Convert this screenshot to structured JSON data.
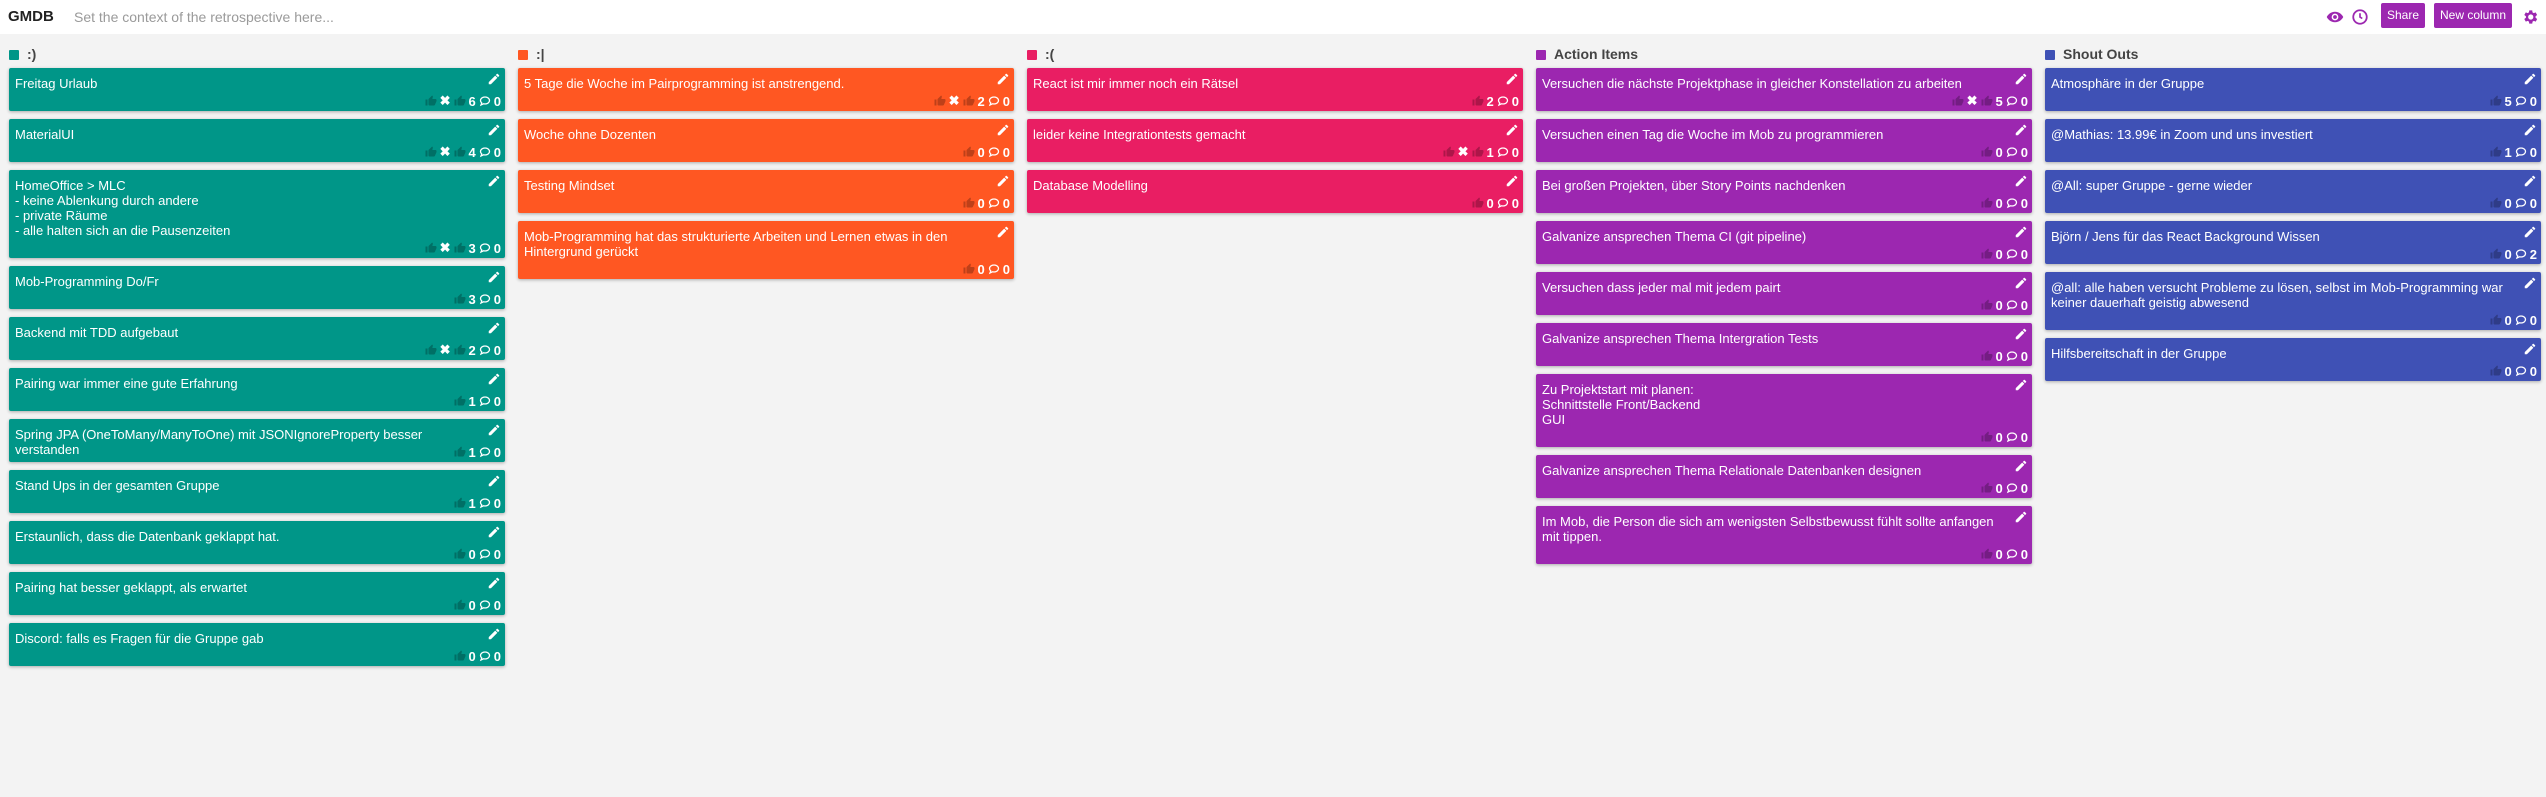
{
  "header": {
    "brand": "GMDB",
    "context_placeholder": "Set the context of the retrospective here...",
    "context_value": "",
    "share_label": "Share",
    "new_column_label": "New column"
  },
  "icons": {
    "visibility": "eye-icon",
    "timer": "clock-icon",
    "settings": "gear-icon",
    "edit": "pencil-icon",
    "thumbs_up": "thumbs-up-icon",
    "delete": "x-icon",
    "comment": "comment-icon"
  },
  "accent": "#9c27b0",
  "add_label": "+",
  "columns": [
    {
      "title": ":)",
      "color": "#009688",
      "cards": [
        {
          "text": "Freitag Urlaub",
          "votes": "6",
          "comments": "0",
          "deletable": true
        },
        {
          "text": "MaterialUI",
          "votes": "4",
          "comments": "0",
          "deletable": true
        },
        {
          "text": "HomeOffice > MLC\n- keine Ablenkung durch andere\n- private Räume\n- alle halten sich an die Pausenzeiten",
          "votes": "3",
          "comments": "0",
          "deletable": true
        },
        {
          "text": "Mob-Programming Do/Fr",
          "votes": "3",
          "comments": "0",
          "deletable": false
        },
        {
          "text": "Backend mit TDD aufgebaut",
          "votes": "2",
          "comments": "0",
          "deletable": true
        },
        {
          "text": "Pairing war immer eine gute Erfahrung",
          "votes": "1",
          "comments": "0",
          "deletable": false
        },
        {
          "text": "Spring JPA (OneToMany/ManyToOne) mit JSONIgnoreProperty besser verstanden",
          "votes": "1",
          "comments": "0",
          "deletable": false
        },
        {
          "text": "Stand Ups in der gesamten Gruppe",
          "votes": "1",
          "comments": "0",
          "deletable": false
        },
        {
          "text": "Erstaunlich, dass die Datenbank geklappt hat.",
          "votes": "0",
          "comments": "0",
          "deletable": false
        },
        {
          "text": "Pairing hat besser geklappt, als erwartet",
          "votes": "0",
          "comments": "0",
          "deletable": false
        },
        {
          "text": "Discord: falls es Fragen für die Gruppe gab",
          "votes": "0",
          "comments": "0",
          "deletable": false
        }
      ]
    },
    {
      "title": ":|",
      "color": "#ff5722",
      "cards": [
        {
          "text": "5 Tage die Woche im Pairprogramming ist anstrengend.",
          "votes": "2",
          "comments": "0",
          "deletable": true
        },
        {
          "text": "Woche ohne Dozenten",
          "votes": "0",
          "comments": "0",
          "deletable": false
        },
        {
          "text": "Testing Mindset",
          "votes": "0",
          "comments": "0",
          "deletable": false
        },
        {
          "text": "Mob-Programming hat das strukturierte Arbeiten und Lernen etwas in den Hintergrund gerückt",
          "votes": "0",
          "comments": "0",
          "deletable": false
        }
      ]
    },
    {
      "title": ":(",
      "color": "#e91e63",
      "cards": [
        {
          "text": "React ist mir immer noch ein Rätsel",
          "votes": "2",
          "comments": "0",
          "deletable": false
        },
        {
          "text": "leider keine Integrationtests gemacht",
          "votes": "1",
          "comments": "0",
          "deletable": true
        },
        {
          "text": "Database Modelling",
          "votes": "0",
          "comments": "0",
          "deletable": false
        }
      ]
    },
    {
      "title": "Action Items",
      "color": "#9c27b0",
      "cards": [
        {
          "text": "Versuchen die nächste Projektphase in gleicher Konstellation zu arbeiten",
          "votes": "5",
          "comments": "0",
          "deletable": true
        },
        {
          "text": "Versuchen einen Tag die Woche im Mob zu programmieren",
          "votes": "0",
          "comments": "0",
          "deletable": false
        },
        {
          "text": "Bei großen Projekten, über Story Points nachdenken",
          "votes": "0",
          "comments": "0",
          "deletable": false
        },
        {
          "text": "Galvanize ansprechen Thema CI (git pipeline)",
          "votes": "0",
          "comments": "0",
          "deletable": false
        },
        {
          "text": "Versuchen dass jeder mal mit jedem pairt",
          "votes": "0",
          "comments": "0",
          "deletable": false
        },
        {
          "text": "Galvanize ansprechen Thema Intergration Tests",
          "votes": "0",
          "comments": "0",
          "deletable": false
        },
        {
          "text": "Zu Projektstart mit planen:\nSchnittstelle Front/Backend\nGUI",
          "votes": "0",
          "comments": "0",
          "deletable": false
        },
        {
          "text": "Galvanize ansprechen Thema Relationale Datenbanken designen",
          "votes": "0",
          "comments": "0",
          "deletable": false
        },
        {
          "text": "Im Mob, die Person die sich am wenigsten Selbstbewusst fühlt sollte anfangen mit tippen.",
          "votes": "0",
          "comments": "0",
          "deletable": false
        }
      ]
    },
    {
      "title": "Shout Outs",
      "color": "#3f51b5",
      "cards": [
        {
          "text": "Atmosphäre in der Gruppe",
          "votes": "5",
          "comments": "0",
          "deletable": false
        },
        {
          "text": "@Mathias: 13.99€ in Zoom und uns investiert",
          "votes": "1",
          "comments": "0",
          "deletable": false
        },
        {
          "text": "@All: super Gruppe - gerne wieder",
          "votes": "0",
          "comments": "0",
          "deletable": false
        },
        {
          "text": "Björn / Jens für das React Background Wissen",
          "votes": "0",
          "comments": "2",
          "deletable": false
        },
        {
          "text": "@all: alle haben versucht Probleme zu lösen, selbst im Mob-Programming war keiner dauerhaft geistig abwesend",
          "votes": "0",
          "comments": "0",
          "deletable": false
        },
        {
          "text": "Hilfsbereitschaft in der Gruppe",
          "votes": "0",
          "comments": "0",
          "deletable": false
        }
      ]
    }
  ]
}
